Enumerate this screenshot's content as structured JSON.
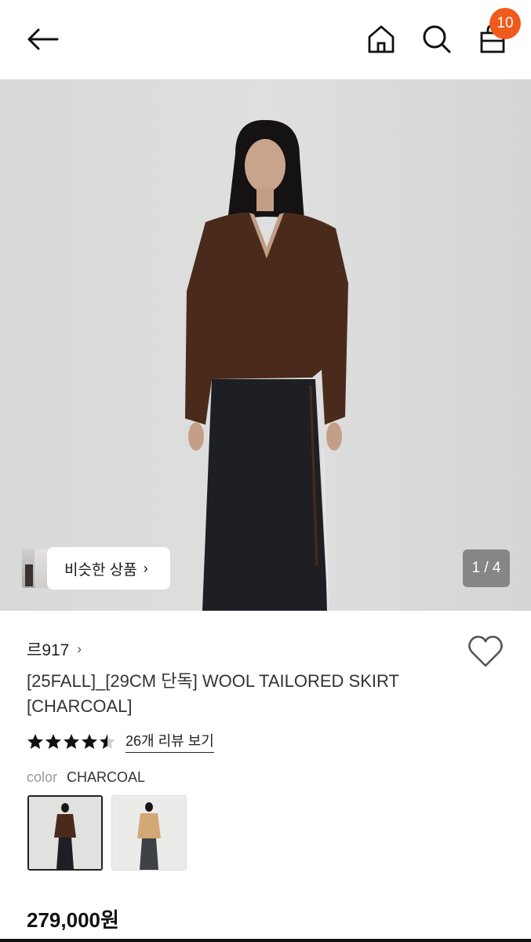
{
  "header": {
    "back_icon": "arrow-left-icon",
    "home_icon": "home-icon",
    "search_icon": "search-icon",
    "bag_icon": "shopping-bag-icon",
    "cart_count": "10",
    "badge_color": "#f05a1c"
  },
  "gallery": {
    "similar_label": "비슷한 상품",
    "counter": "1 / 4"
  },
  "product": {
    "brand": "르917",
    "title": "[25FALL]_[29CM 단독] WOOL TAILORED SKIRT [CHARCOAL]",
    "rating": 4.5,
    "review_link": "26개 리뷰 보기",
    "color_label": "color",
    "color_value": "CHARCOAL",
    "price": "279,000원"
  }
}
